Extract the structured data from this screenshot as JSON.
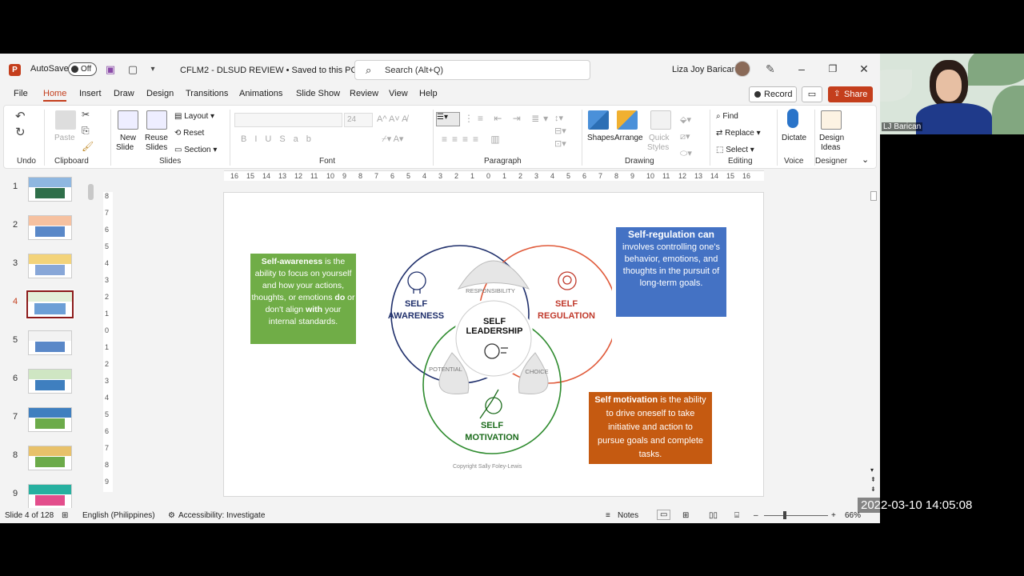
{
  "titlebar": {
    "logo": "P",
    "autosave_label": "AutoSave",
    "autosave_state": "Off",
    "file_title": "CFLM2 - DLSUD REVIEW • Saved to this PC",
    "search_placeholder": "Search (Alt+Q)",
    "user_name": "Liza Joy  Barican"
  },
  "menu": [
    "File",
    "Home",
    "Insert",
    "Draw",
    "Design",
    "Transitions",
    "Animations",
    "Slide Show",
    "Review",
    "View",
    "Help"
  ],
  "menu_active": "Home",
  "buttons": {
    "record": "Record",
    "share": "Share"
  },
  "ribbon": {
    "undo": "Undo",
    "clipboard": "Clipboard",
    "paste": "Paste",
    "slides": "Slides",
    "new_slide": "New",
    "new_slide2": "Slide",
    "reuse": "Reuse",
    "reuse2": "Slides",
    "layout": "Layout",
    "reset": "Reset",
    "section": "Section",
    "font": "Font",
    "font_size": "24",
    "paragraph": "Paragraph",
    "drawing": "Drawing",
    "shapes": "Shapes",
    "arrange": "Arrange",
    "quick": "Quick",
    "quick2": "Styles",
    "editing": "Editing",
    "find": "Find",
    "replace": "Replace",
    "select": "Select",
    "voice": "Voice",
    "dictate": "Dictate",
    "designer": "Designer",
    "design_ideas": "Design",
    "design_ideas2": "Ideas"
  },
  "ruler_h": [
    "16",
    "15",
    "14",
    "13",
    "12",
    "11",
    "10",
    "9",
    "8",
    "7",
    "6",
    "5",
    "4",
    "3",
    "2",
    "1",
    "0",
    "1",
    "2",
    "3",
    "4",
    "5",
    "6",
    "7",
    "8",
    "9",
    "10",
    "11",
    "12",
    "13",
    "14",
    "15",
    "16"
  ],
  "ruler_v": [
    "8",
    "7",
    "6",
    "5",
    "4",
    "3",
    "2",
    "1",
    "0",
    "1",
    "2",
    "3",
    "4",
    "5",
    "6",
    "7",
    "8",
    "9"
  ],
  "thumbnails": [
    "1",
    "2",
    "3",
    "4",
    "5",
    "6",
    "7",
    "8",
    "9"
  ],
  "selected_slide": "4",
  "slide": {
    "self_awareness_bold": "Self-awareness",
    "self_awareness_t1": " is the ability to focus on yourself and how your actions, thoughts, or emotions ",
    "self_awareness_do": "do",
    "self_awareness_t2": " or don't align ",
    "self_awareness_with": "with",
    "self_awareness_t3": " your internal standards.",
    "regulation_bold": "Self-regulation can",
    "regulation_text": " involves controlling one's behavior, emotions, and thoughts in the pursuit of long-term goals.",
    "motivation_bold": "Self motivation",
    "motivation_text": " is the ability to drive oneself to take initiative and action to pursue goals and complete tasks.",
    "circle_awareness_1": "SELF",
    "circle_awareness_2": "AWARENESS",
    "circle_regulation_1": "SELF",
    "circle_regulation_2": "REGULATION",
    "circle_motivation_1": "SELF",
    "circle_motivation_2": "MOTIVATION",
    "center_1": "SELF",
    "center_2": "LEADERSHIP",
    "responsibility": "RESPONSIBILITY",
    "potential": "POTENTIAL",
    "choice": "CHOICE",
    "copyright": "Copyright Sally Foley-Lewis"
  },
  "colors": {
    "awareness": "#1f2f6b",
    "regulation": "#e05a3a",
    "motivation": "#2e8b2e",
    "green_box": "#70ad47",
    "blue_box": "#4472c4",
    "orange_box": "#c55a11",
    "accent": "#c43e1c"
  },
  "status": {
    "slide_count": "Slide 4 of 128",
    "language": "English (Philippines)",
    "accessibility": "Accessibility: Investigate",
    "notes": "Notes",
    "zoom": "66%"
  },
  "webcam": {
    "name": "LJ Barican"
  },
  "timestamp": "2022-03-10  14:05:08"
}
